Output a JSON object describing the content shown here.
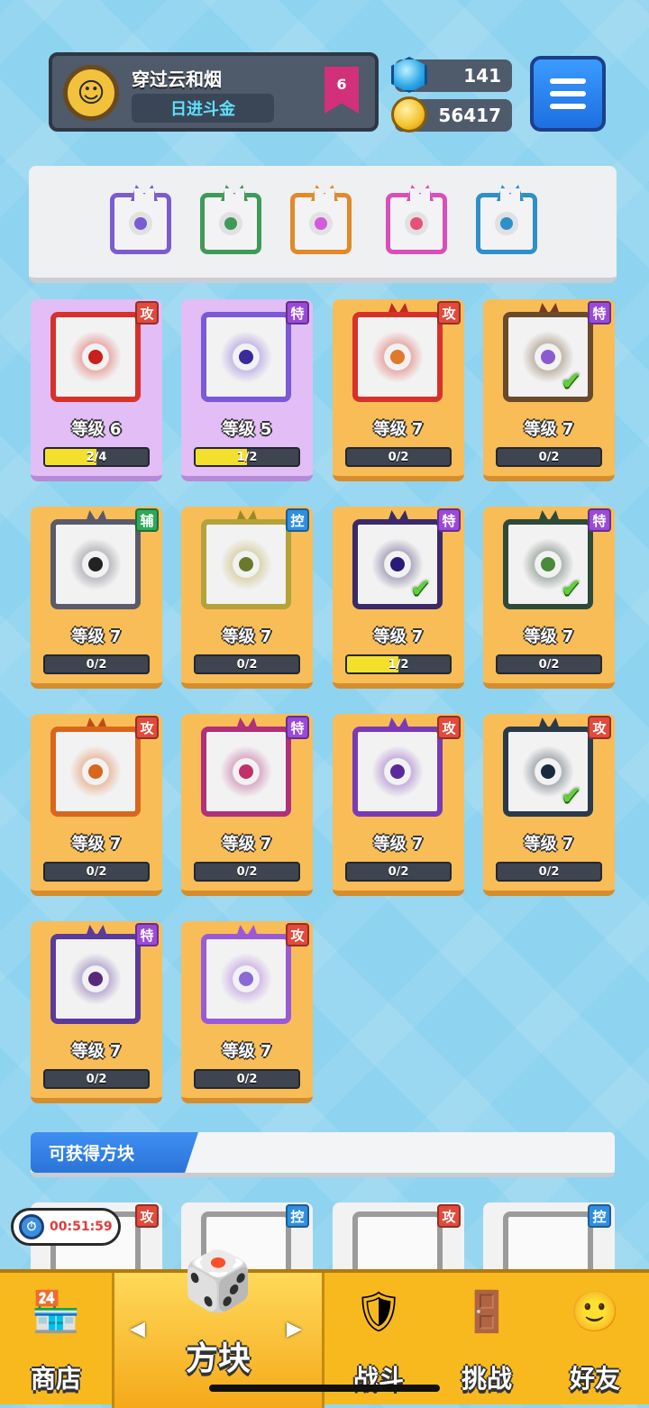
{
  "profile": {
    "name": "穿过云和烟",
    "title": "日进斗金",
    "rank": "6",
    "avatar_icon": "avatar-icon"
  },
  "currency": {
    "gems": "141",
    "coins": "56417"
  },
  "deck": [
    {
      "icon": "dragon-purple-block",
      "color": "#7b5bd2",
      "core": "#7b5bd2"
    },
    {
      "icon": "dragon-green-block",
      "color": "#3f9a58",
      "core": "#3f9a58"
    },
    {
      "icon": "dragon-rainbow-block",
      "color": "#e08a2a",
      "core": "#d35bd9"
    },
    {
      "icon": "rainbow-block",
      "color": "#d94fb8",
      "core": "#e7507a"
    },
    {
      "icon": "dragon-blue-block",
      "color": "#2f8fc8",
      "core": "#2f8fc8"
    }
  ],
  "level_prefix": "等级",
  "cards": [
    {
      "tag": "攻",
      "tag_type": "atk",
      "level": "等级 6",
      "progress": "2/4",
      "fill": 0.5,
      "bg": "purple",
      "frame": "#d6322b",
      "core": "#c8201c",
      "check": false,
      "horn": ""
    },
    {
      "tag": "特",
      "tag_type": "spc",
      "level": "等级 5",
      "progress": "1/2",
      "fill": 0.5,
      "bg": "purple",
      "frame": "#7a5ad6",
      "core": "#3a2a9c",
      "check": false,
      "horn": ""
    },
    {
      "tag": "攻",
      "tag_type": "atk",
      "level": "等级 7",
      "progress": "0/2",
      "fill": 0,
      "bg": "orange",
      "frame": "#d6322b",
      "core": "#e07a2a",
      "check": false,
      "horn": "#c4281e"
    },
    {
      "tag": "特",
      "tag_type": "spc",
      "level": "等级 7",
      "progress": "0/2",
      "fill": 0,
      "bg": "orange",
      "frame": "#6a4a2a",
      "core": "#8c5ad0",
      "check": true,
      "horn": "#7a3a1e"
    },
    {
      "tag": "辅",
      "tag_type": "sup",
      "level": "等级 7",
      "progress": "0/2",
      "fill": 0,
      "bg": "orange",
      "frame": "#5a5a6a",
      "core": "#222",
      "check": false,
      "horn": "#5a5a6a"
    },
    {
      "tag": "控",
      "tag_type": "ctl",
      "level": "等级 7",
      "progress": "0/2",
      "fill": 0,
      "bg": "orange",
      "frame": "#b4a23a",
      "core": "#6a7a2a",
      "check": false,
      "horn": "#9a8a22"
    },
    {
      "tag": "特",
      "tag_type": "spc",
      "level": "等级 7",
      "progress": "1/2",
      "fill": 0.5,
      "bg": "orange",
      "frame": "#3a2a6a",
      "core": "#2a1a7a",
      "check": true,
      "horn": "#3a2a6a"
    },
    {
      "tag": "特",
      "tag_type": "spc",
      "level": "等级 7",
      "progress": "0/2",
      "fill": 0,
      "bg": "orange",
      "frame": "#2e4a3a",
      "core": "#4a8a3a",
      "check": true,
      "horn": "#2e4a3a"
    },
    {
      "tag": "攻",
      "tag_type": "atk",
      "level": "等级 7",
      "progress": "0/2",
      "fill": 0,
      "bg": "orange",
      "frame": "#d9661e",
      "core": "#d9661e",
      "check": false,
      "horn": "#c04a14"
    },
    {
      "tag": "特",
      "tag_type": "spc",
      "level": "等级 7",
      "progress": "0/2",
      "fill": 0,
      "bg": "orange",
      "frame": "#b0307a",
      "core": "#c0306a",
      "check": false,
      "horn": "#b0307a"
    },
    {
      "tag": "攻",
      "tag_type": "atk",
      "level": "等级 7",
      "progress": "0/2",
      "fill": 0,
      "bg": "orange",
      "frame": "#7a3ab4",
      "core": "#5a2a9c",
      "check": false,
      "horn": "#7a3ab4"
    },
    {
      "tag": "攻",
      "tag_type": "atk",
      "level": "等级 7",
      "progress": "0/2",
      "fill": 0,
      "bg": "orange",
      "frame": "#2a3a4a",
      "core": "#1a2a3a",
      "check": true,
      "horn": "#2a3a4a"
    },
    {
      "tag": "特",
      "tag_type": "spc",
      "level": "等级 7",
      "progress": "0/2",
      "fill": 0,
      "bg": "orange",
      "frame": "#5a3a9a",
      "core": "#5a2a7a",
      "check": false,
      "horn": "#5a3a9a"
    },
    {
      "tag": "攻",
      "tag_type": "atk",
      "level": "等级 7",
      "progress": "0/2",
      "fill": 0,
      "bg": "orange",
      "frame": "#9a5ad6",
      "core": "#8a6ad6",
      "check": false,
      "horn": "#9a5ad6"
    }
  ],
  "obtainable": {
    "label": "可获得方块",
    "tags": [
      {
        "tag": "攻",
        "tag_type": "atk"
      },
      {
        "tag": "控",
        "tag_type": "ctl"
      },
      {
        "tag": "攻",
        "tag_type": "atk"
      },
      {
        "tag": "控",
        "tag_type": "ctl"
      }
    ]
  },
  "timer": "00:51:59",
  "nav": [
    {
      "label": "商店",
      "icon": "shop-icon",
      "glyph": "🏪"
    },
    {
      "label": "方块",
      "icon": "block-icon",
      "glyph": "🎲",
      "active": true
    },
    {
      "label": "战斗",
      "icon": "battle-icon",
      "glyph": "🛡"
    },
    {
      "label": "挑战",
      "icon": "challenge-icon",
      "glyph": "🚪"
    },
    {
      "label": "好友",
      "icon": "friends-icon",
      "glyph": "🙂"
    }
  ]
}
